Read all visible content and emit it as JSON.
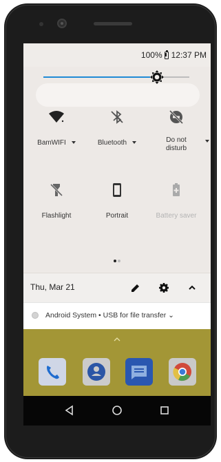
{
  "status_bar": {
    "battery_percent": "100%",
    "time": "12:37 PM"
  },
  "brightness": {
    "level": 0.78
  },
  "quick_tiles": [
    {
      "label": "BamWIFI",
      "icon": "wifi-icon",
      "has_dropdown": true,
      "state": "on"
    },
    {
      "label": "Bluetooth",
      "icon": "bluetooth-off-icon",
      "has_dropdown": true,
      "state": "off"
    },
    {
      "label": "Do not disturb",
      "line1": "Do not",
      "line2": "disturb",
      "icon": "do-not-disturb-icon",
      "has_dropdown": true,
      "state": "off"
    },
    {
      "label": "Flashlight",
      "icon": "flashlight-off-icon",
      "state": "off"
    },
    {
      "label": "Portrait",
      "icon": "screen-rotation-portrait-icon",
      "state": "on"
    },
    {
      "label": "Battery saver",
      "icon": "battery-saver-icon",
      "state": "unavailable"
    }
  ],
  "page_indicator": {
    "pages": 2,
    "current": 1
  },
  "footer": {
    "date": "Thu, Mar 21"
  },
  "notification": {
    "text": "Android System • USB for file transfer ⌄"
  },
  "dock": [
    "phone-app-icon",
    "contacts-app-icon",
    "messages-app-icon",
    "chrome-app-icon"
  ],
  "nav_bar": [
    "back-icon",
    "home-icon",
    "recents-icon"
  ],
  "colors": {
    "accent": "#1f8ad6",
    "home_wallpaper": "#a39636",
    "panel": "#ede9e6"
  }
}
